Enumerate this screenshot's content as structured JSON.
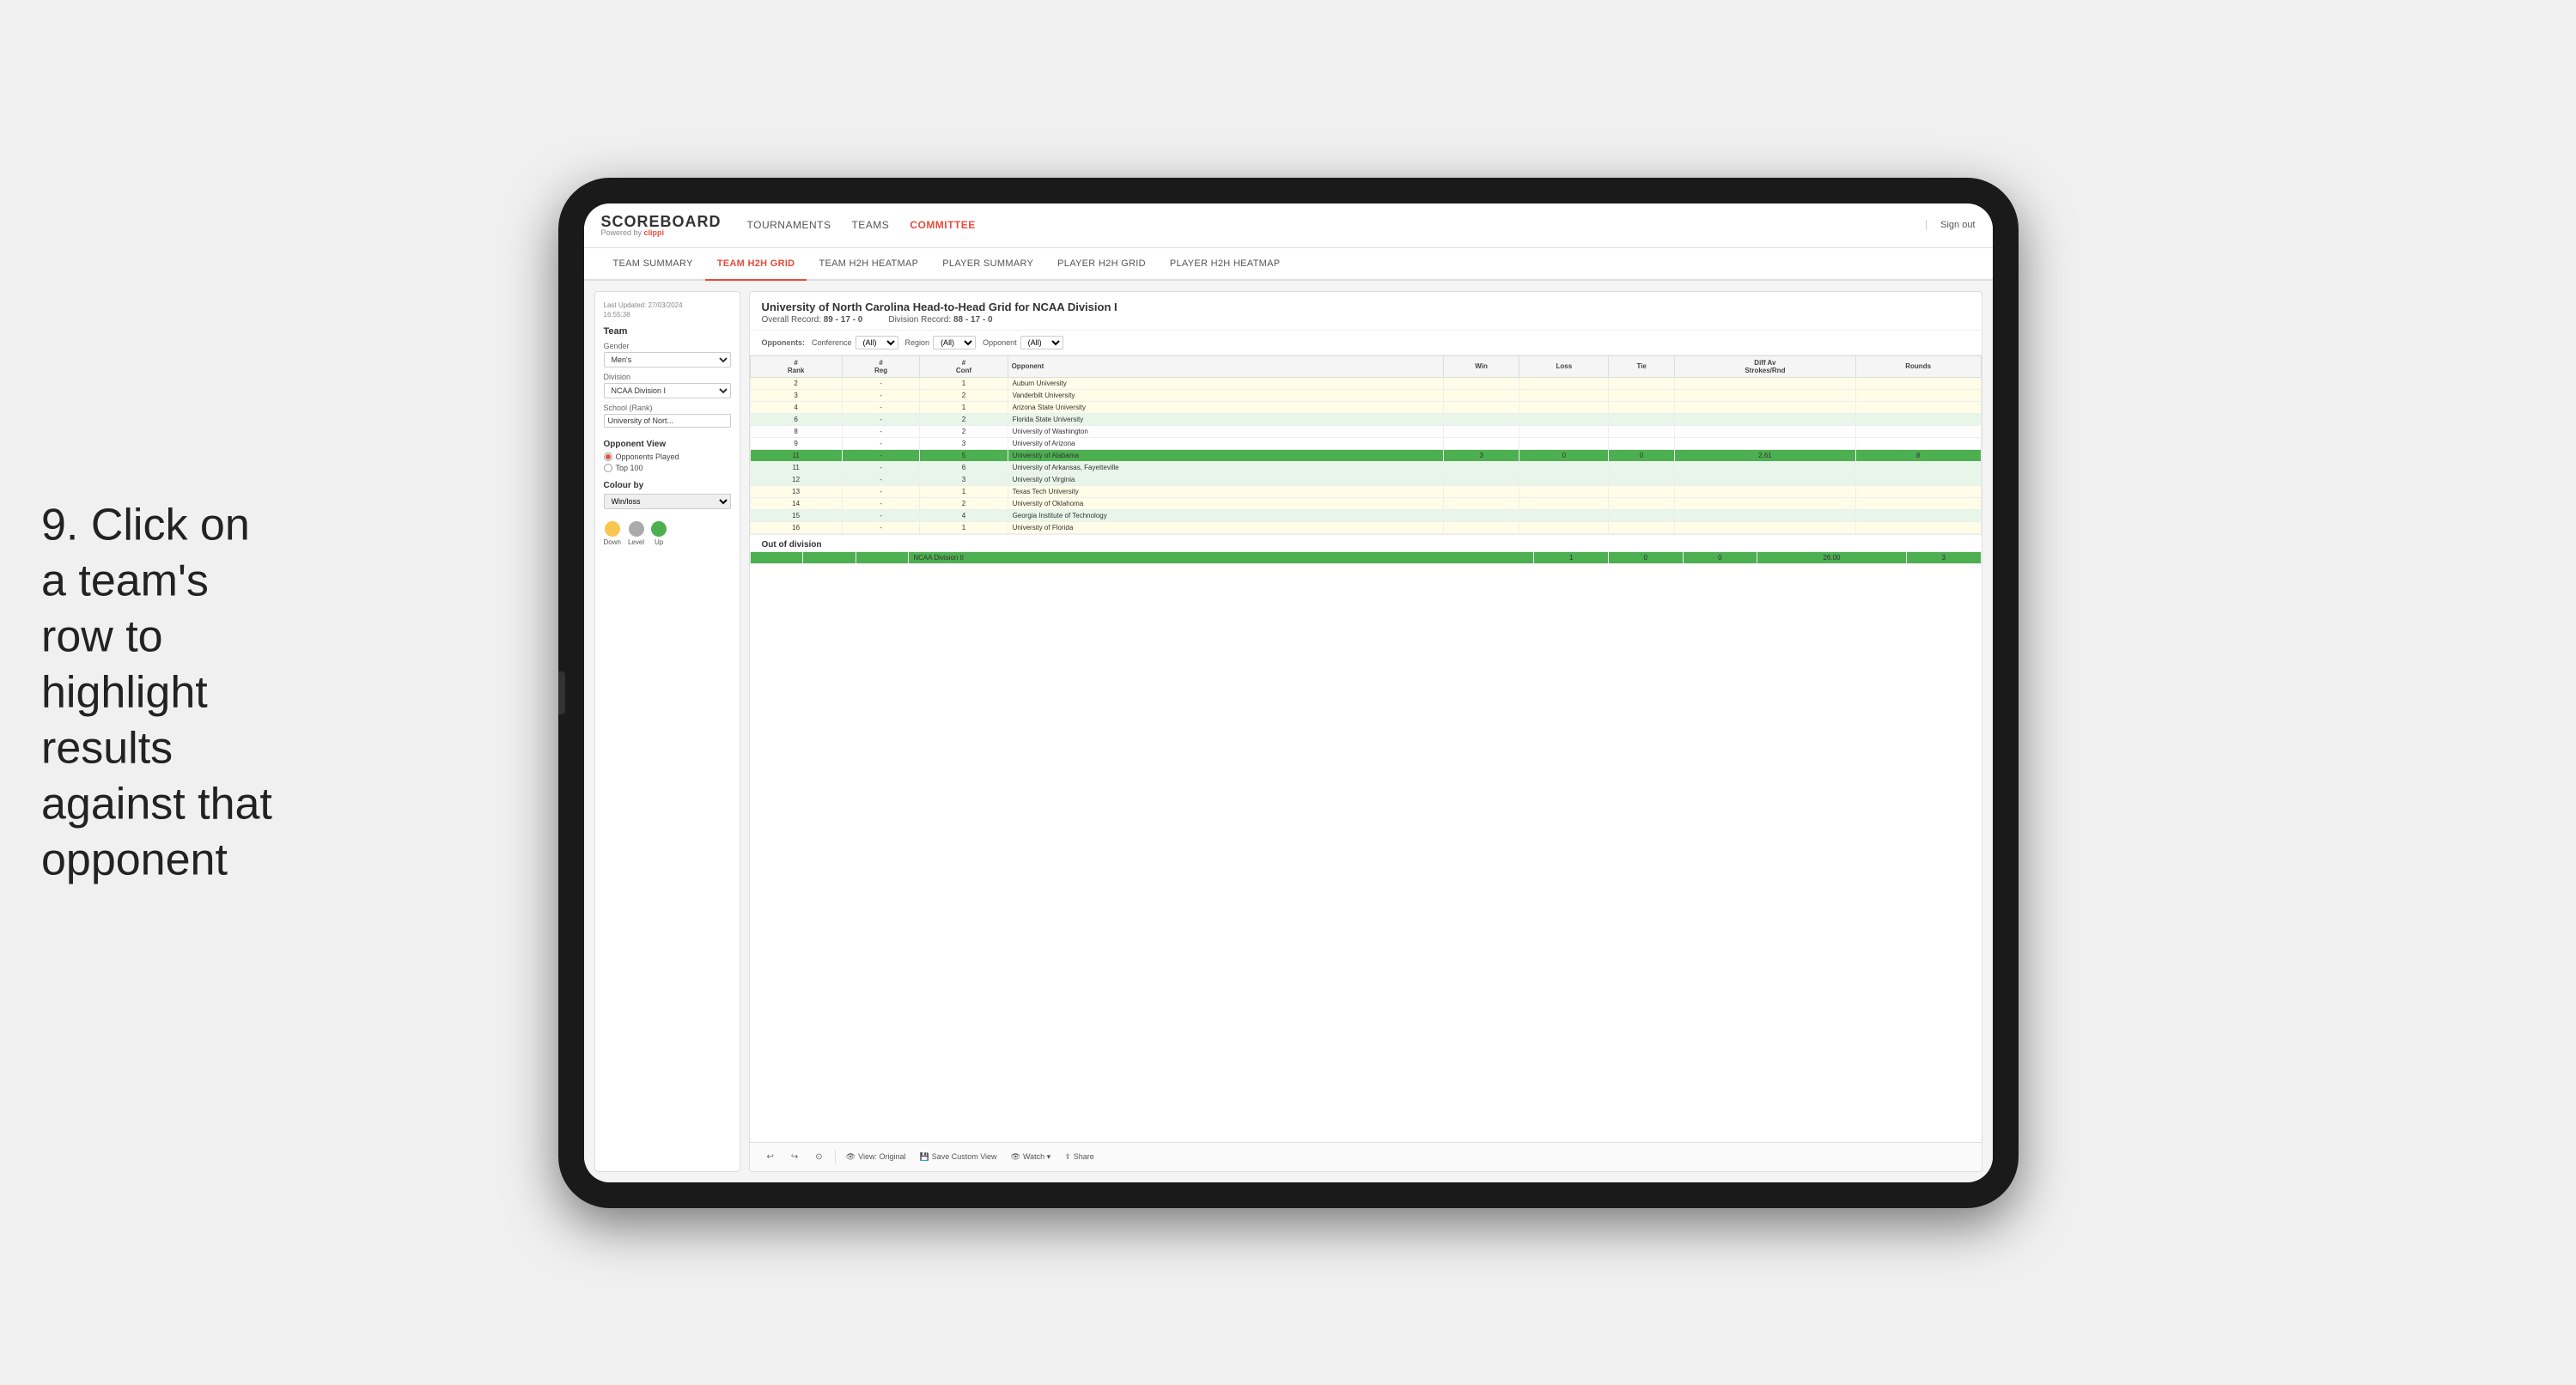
{
  "instruction": {
    "step": "9.",
    "text": "Click on a team's row to highlight results against that opponent"
  },
  "nav": {
    "logo": "SCOREBOARD",
    "powered_by": "Powered by",
    "brand": "clippi",
    "items": [
      {
        "label": "TOURNAMENTS",
        "active": false
      },
      {
        "label": "TEAMS",
        "active": false
      },
      {
        "label": "COMMITTEE",
        "active": true
      }
    ],
    "sign_out": "Sign out"
  },
  "sub_nav": {
    "items": [
      {
        "label": "TEAM SUMMARY",
        "active": false
      },
      {
        "label": "TEAM H2H GRID",
        "active": true
      },
      {
        "label": "TEAM H2H HEATMAP",
        "active": false
      },
      {
        "label": "PLAYER SUMMARY",
        "active": false
      },
      {
        "label": "PLAYER H2H GRID",
        "active": false
      },
      {
        "label": "PLAYER H2H HEATMAP",
        "active": false
      }
    ]
  },
  "left_panel": {
    "last_updated_label": "Last Updated: 27/03/2024",
    "time": "16:55:38",
    "team_label": "Team",
    "gender_label": "Gender",
    "gender_value": "Men's",
    "division_label": "Division",
    "division_value": "NCAA Division I",
    "school_rank_label": "School (Rank)",
    "school_rank_value": "University of Nort...",
    "opponent_view_label": "Opponent View",
    "radio_options": [
      {
        "label": "Opponents Played",
        "selected": true
      },
      {
        "label": "Top 100",
        "selected": false
      }
    ],
    "colour_by_label": "Colour by",
    "colour_by_value": "Win/loss",
    "legend": [
      {
        "label": "Down",
        "color": "#f9c74f"
      },
      {
        "label": "Level",
        "color": "#aaaaaa"
      },
      {
        "label": "Up",
        "color": "#4caf50"
      }
    ]
  },
  "grid": {
    "title": "University of North Carolina Head-to-Head Grid for NCAA Division I",
    "overall_record_label": "Overall Record:",
    "overall_record": "89 - 17 - 0",
    "division_record_label": "Division Record:",
    "division_record": "88 - 17 - 0",
    "filters": {
      "opponents_label": "Opponents:",
      "conference_label": "Conference",
      "conference_value": "(All)",
      "region_label": "Region",
      "region_value": "(All)",
      "opponent_label": "Opponent",
      "opponent_value": "(All)"
    },
    "columns": [
      "#\nRank",
      "#\nReg",
      "#\nConf",
      "Opponent",
      "Win",
      "Loss",
      "Tie",
      "Diff Av\nStrokes/Rnd",
      "Rounds"
    ],
    "rows": [
      {
        "rank": "2",
        "reg": "-",
        "conf": "1",
        "opponent": "Auburn University",
        "win": "",
        "loss": "",
        "tie": "",
        "diff": "",
        "rounds": "",
        "style": "light-yellow"
      },
      {
        "rank": "3",
        "reg": "-",
        "conf": "2",
        "opponent": "Vanderbilt University",
        "win": "",
        "loss": "",
        "tie": "",
        "diff": "",
        "rounds": "",
        "style": "light-yellow"
      },
      {
        "rank": "4",
        "reg": "-",
        "conf": "1",
        "opponent": "Arizona State University",
        "win": "",
        "loss": "",
        "tie": "",
        "diff": "",
        "rounds": "",
        "style": "light-yellow"
      },
      {
        "rank": "6",
        "reg": "-",
        "conf": "2",
        "opponent": "Florida State University",
        "win": "",
        "loss": "",
        "tie": "",
        "diff": "",
        "rounds": "",
        "style": "light-green"
      },
      {
        "rank": "8",
        "reg": "-",
        "conf": "2",
        "opponent": "University of Washington",
        "win": "",
        "loss": "",
        "tie": "",
        "diff": "",
        "rounds": "",
        "style": "normal"
      },
      {
        "rank": "9",
        "reg": "-",
        "conf": "3",
        "opponent": "University of Arizona",
        "win": "",
        "loss": "",
        "tie": "",
        "diff": "",
        "rounds": "",
        "style": "normal"
      },
      {
        "rank": "11",
        "reg": "-",
        "conf": "5",
        "opponent": "University of Alabama",
        "win": "3",
        "loss": "0",
        "tie": "0",
        "diff": "2.61",
        "rounds": "8",
        "style": "highlighted"
      },
      {
        "rank": "11",
        "reg": "-",
        "conf": "6",
        "opponent": "University of Arkansas, Fayetteville",
        "win": "",
        "loss": "",
        "tie": "",
        "diff": "",
        "rounds": "",
        "style": "light-green"
      },
      {
        "rank": "12",
        "reg": "-",
        "conf": "3",
        "opponent": "University of Virginia",
        "win": "",
        "loss": "",
        "tie": "",
        "diff": "",
        "rounds": "",
        "style": "light-green"
      },
      {
        "rank": "13",
        "reg": "-",
        "conf": "1",
        "opponent": "Texas Tech University",
        "win": "",
        "loss": "",
        "tie": "",
        "diff": "",
        "rounds": "",
        "style": "light-yellow"
      },
      {
        "rank": "14",
        "reg": "-",
        "conf": "2",
        "opponent": "University of Oklahoma",
        "win": "",
        "loss": "",
        "tie": "",
        "diff": "",
        "rounds": "",
        "style": "light-yellow"
      },
      {
        "rank": "15",
        "reg": "-",
        "conf": "4",
        "opponent": "Georgia Institute of Technology",
        "win": "",
        "loss": "",
        "tie": "",
        "diff": "",
        "rounds": "",
        "style": "light-green"
      },
      {
        "rank": "16",
        "reg": "-",
        "conf": "1",
        "opponent": "University of Florida",
        "win": "",
        "loss": "",
        "tie": "",
        "diff": "",
        "rounds": "",
        "style": "light-yellow"
      }
    ],
    "out_of_division_label": "Out of division",
    "out_of_division_row": {
      "division": "NCAA Division II",
      "win": "1",
      "loss": "0",
      "tie": "0",
      "diff": "26.00",
      "rounds": "3"
    }
  },
  "toolbar": {
    "undo_label": "↩",
    "redo_label": "↪",
    "view_label": "View: Original",
    "save_label": "Save Custom View",
    "watch_label": "Watch ▾",
    "share_label": "Share"
  }
}
